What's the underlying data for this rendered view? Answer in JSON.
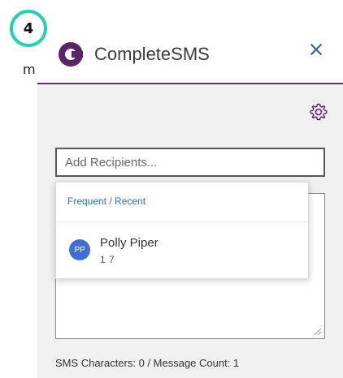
{
  "step": {
    "number": "4"
  },
  "left_strip": {
    "text": "m"
  },
  "app": {
    "title": "CompleteSMS",
    "accent": "#6b2a74",
    "logo_color": "#5a2466"
  },
  "recipients": {
    "placeholder": "Add Recipients..."
  },
  "dropdown": {
    "section_label": "Frequent / Recent",
    "contacts": [
      {
        "initials": "PP",
        "name": "Polly Piper",
        "phone": "1            7"
      }
    ]
  },
  "footer": {
    "status": "SMS Characters: 0 / Message Count: 1"
  },
  "icons": {
    "close": "close-icon",
    "settings": "gear-icon",
    "logo": "completesms-logo-icon"
  }
}
